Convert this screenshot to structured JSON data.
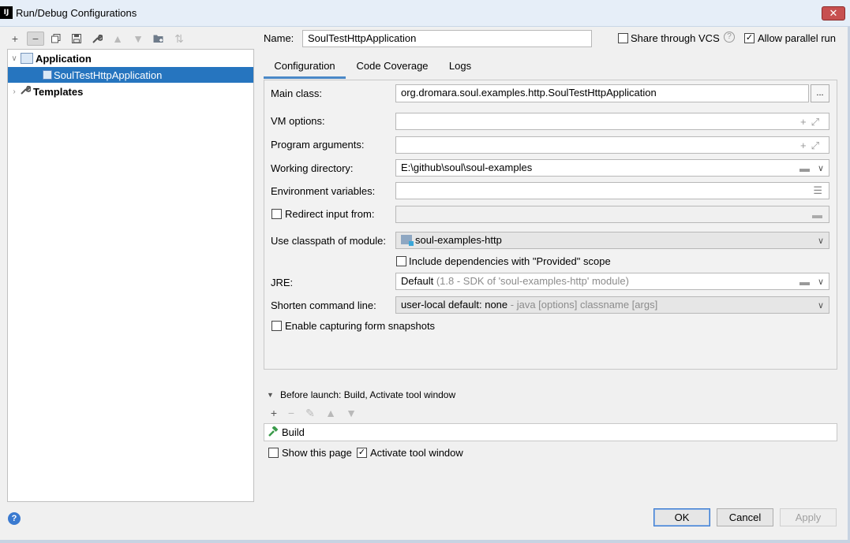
{
  "window": {
    "title": "Run/Debug Configurations",
    "app_icon_text": "IJ",
    "close_symbol": "✕"
  },
  "toolbar": {
    "icons": [
      "plus-icon",
      "minus-icon",
      "copy-icon",
      "save-icon",
      "wrench-icon",
      "arrow-up-icon",
      "arrow-down-icon",
      "folder-add-icon",
      "sort-icon"
    ]
  },
  "tree": {
    "items": [
      {
        "label": "Application",
        "expanded": true
      },
      {
        "label": "SoulTestHttpApplication",
        "selected": true
      },
      {
        "label": "Templates",
        "expanded": false
      }
    ]
  },
  "name_row": {
    "label": "Name:",
    "value": "SoulTestHttpApplication",
    "share_label": "Share through VCS",
    "share_checked": false,
    "parallel_label": "Allow parallel run",
    "parallel_checked": true
  },
  "tabs": [
    {
      "label": "Configuration",
      "active": true
    },
    {
      "label": "Code Coverage"
    },
    {
      "label": "Logs"
    }
  ],
  "config": {
    "main_class_label": "Main class:",
    "main_class_value": "org.dromara.soul.examples.http.SoulTestHttpApplication",
    "browse_label": "...",
    "vm_options_label": "VM options:",
    "vm_options_value": "",
    "program_args_label": "Program arguments:",
    "program_args_value": "",
    "working_dir_label": "Working directory:",
    "working_dir_value": "E:\\github\\soul\\soul-examples",
    "env_vars_label": "Environment variables:",
    "env_vars_value": "",
    "redirect_label": "Redirect input from:",
    "redirect_checked": false,
    "classpath_label": "Use classpath of module:",
    "classpath_value": "soul-examples-http",
    "include_deps_label": "Include dependencies with \"Provided\" scope",
    "include_deps_checked": false,
    "jre_label": "JRE:",
    "jre_value": "Default",
    "jre_detail": "(1.8 - SDK of 'soul-examples-http' module)",
    "shorten_label": "Shorten command line:",
    "shorten_value": "user-local default: none",
    "shorten_detail": "- java [options] classname [args]",
    "snapshots_label": "Enable capturing form snapshots",
    "snapshots_checked": false
  },
  "before_launch": {
    "header": "Before launch: Build, Activate tool window",
    "items": [
      "Build"
    ],
    "show_page_label": "Show this page",
    "show_page_checked": false,
    "activate_label": "Activate tool window",
    "activate_checked": true
  },
  "buttons": {
    "ok": "OK",
    "cancel": "Cancel",
    "apply": "Apply",
    "help": "?"
  }
}
